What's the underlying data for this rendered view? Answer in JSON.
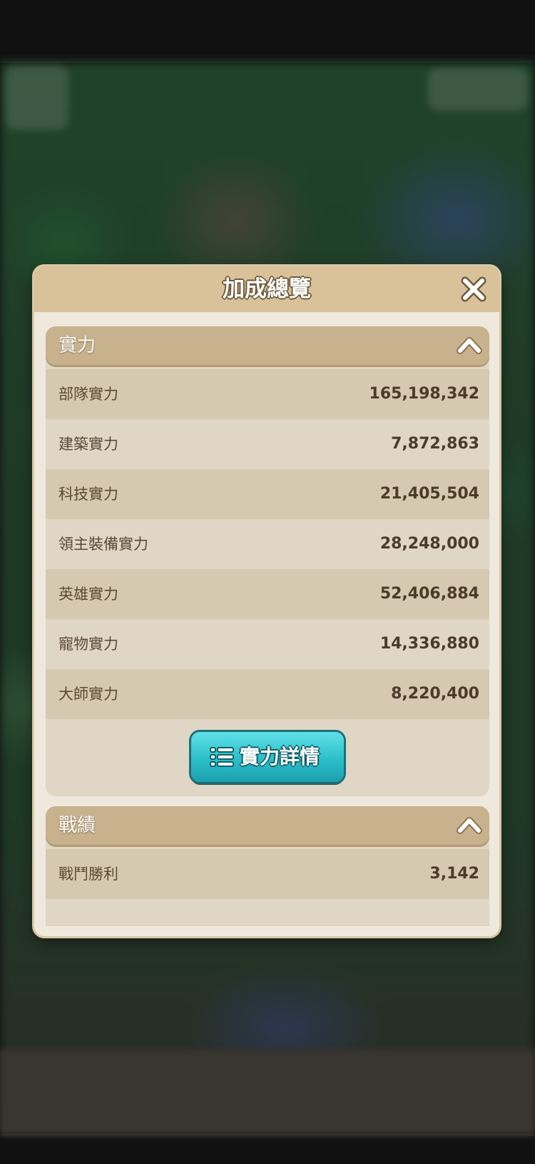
{
  "dialog": {
    "title": "加成總覽"
  },
  "power_section": {
    "title": "實力",
    "rows": [
      {
        "label": "部隊實力",
        "value": "165,198,342"
      },
      {
        "label": "建築實力",
        "value": "7,872,863"
      },
      {
        "label": "科技實力",
        "value": "21,405,504"
      },
      {
        "label": "領主裝備實力",
        "value": "28,248,000"
      },
      {
        "label": "英雄實力",
        "value": "52,406,884"
      },
      {
        "label": "寵物實力",
        "value": "14,336,880"
      },
      {
        "label": "大師實力",
        "value": "8,220,400"
      }
    ],
    "detail_button_label": "實力詳情"
  },
  "record_section": {
    "title": "戰績",
    "rows": [
      {
        "label": "戰鬥勝利",
        "value": "3,142"
      },
      {
        "label": "",
        "value": ""
      }
    ]
  },
  "icons": {
    "close": "close-icon",
    "collapse": "chevron-up-icon",
    "list": "list-icon"
  },
  "colors": {
    "header": "#d9c29a",
    "panel": "#e0d6c5",
    "button": "#2bbfca"
  }
}
